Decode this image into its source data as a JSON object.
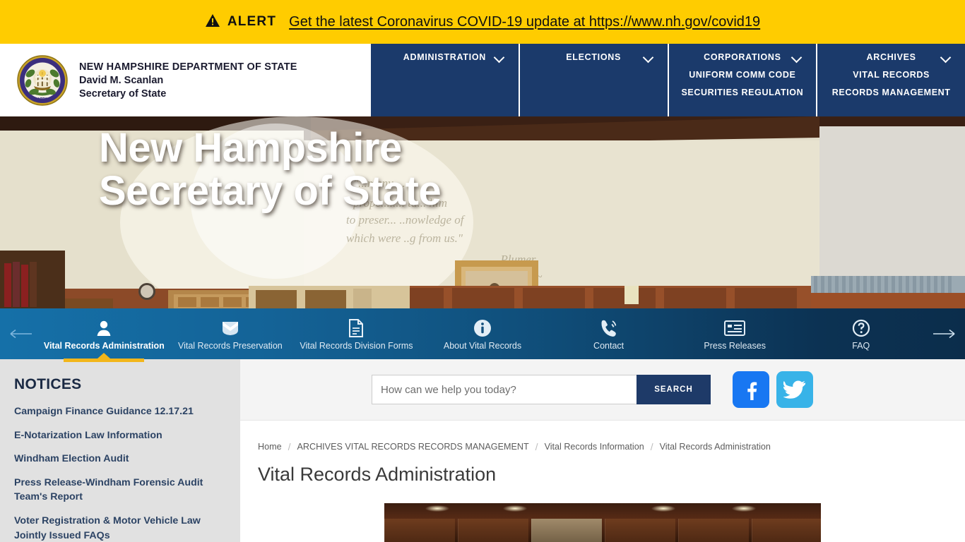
{
  "alert": {
    "icon": "warning-triangle-icon",
    "label": "ALERT",
    "link_text": "Get the latest Coronavirus COVID-19 update at https://www.nh.gov/covid19",
    "bg_color": "#FFCC00"
  },
  "header": {
    "logo_alt": "New Hampshire State Seal 1776",
    "line1": "NEW HAMPSHIRE DEPARTMENT OF STATE",
    "line2": "David M. Scanlan",
    "line3": "Secretary of State",
    "nav_bg": "#1B3A6B",
    "nav": [
      {
        "label": "ADMINISTRATION",
        "has_chevron": true,
        "sub": []
      },
      {
        "label": "ELECTIONS",
        "has_chevron": true,
        "sub": []
      },
      {
        "label": "CORPORATIONS",
        "has_chevron": true,
        "sub": [
          "UNIFORM COMM CODE",
          "SECURITIES REGULATION"
        ]
      },
      {
        "label": "ARCHIVES",
        "has_chevron": true,
        "sub": [
          "VITAL RECORDS",
          "RECORDS MANAGEMENT"
        ]
      }
    ]
  },
  "hero": {
    "title_line1": "New Hampshire",
    "title_line2": "Secretary of State"
  },
  "iconnav": {
    "accent_color": "#F2B61B",
    "prev_arrow": "arrow-left-icon",
    "next_arrow": "arrow-right-icon",
    "items": [
      {
        "label": "Vital Records Administration",
        "icon": "person-icon",
        "active": true
      },
      {
        "label": "Vital Records Preservation",
        "icon": "shield-preservation-icon",
        "active": false
      },
      {
        "label": "Vital Records Division Forms",
        "icon": "document-icon",
        "active": false
      },
      {
        "label": "About Vital Records",
        "icon": "info-circle-icon",
        "active": false
      },
      {
        "label": "Contact",
        "icon": "phone-ringing-icon",
        "active": false
      },
      {
        "label": "Press Releases",
        "icon": "news-list-icon",
        "active": false
      },
      {
        "label": "FAQ",
        "icon": "question-circle-icon",
        "active": false
      }
    ]
  },
  "sidebar": {
    "heading": "NOTICES",
    "notices": [
      "Campaign Finance Guidance 12.17.21",
      "E-Notarization Law Information",
      "Windham Election Audit",
      "Press Release-Windham Forensic Audit Team's Report",
      "Voter Registration & Motor Vehicle Law Jointly Issued FAQs"
    ]
  },
  "search": {
    "placeholder": "How can we help you today?",
    "value": "",
    "button_label": "SEARCH",
    "button_color": "#1E3A68"
  },
  "socials": [
    {
      "name": "facebook-icon",
      "glyph": "f",
      "color": "#1877F2"
    },
    {
      "name": "twitter-icon",
      "glyph": "bird",
      "color": "#38B3E8"
    }
  ],
  "breadcrumb": {
    "separator": "/",
    "items": [
      "Home",
      "ARCHIVES VITAL RECORDS RECORDS MANAGEMENT",
      "Vital Records Information",
      "Vital Records Administration"
    ]
  },
  "main": {
    "page_title": "Vital Records Administration",
    "content_image_alt": "Vital Records archive room shelving"
  }
}
